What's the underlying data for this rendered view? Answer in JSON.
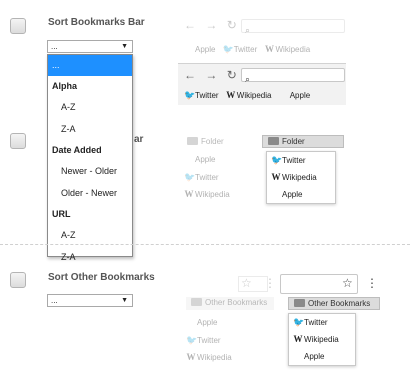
{
  "options": [
    {
      "title": "Sort Bookmarks Bar",
      "value": "...",
      "caret": "▼"
    },
    {
      "title_visible": "ar"
    },
    {
      "title": "Sort Other Bookmarks",
      "value": "...",
      "caret": "▼"
    }
  ],
  "dropdown": {
    "items": [
      {
        "label": "...",
        "kind": "selected"
      },
      {
        "label": "Alpha",
        "kind": "group"
      },
      {
        "label": "A-Z",
        "kind": "sub"
      },
      {
        "label": "Z-A",
        "kind": "sub"
      },
      {
        "label": "Date Added",
        "kind": "group"
      },
      {
        "label": "Newer - Older",
        "kind": "sub"
      },
      {
        "label": "Older - Newer",
        "kind": "sub"
      },
      {
        "label": "URL",
        "kind": "group"
      },
      {
        "label": "A-Z",
        "kind": "sub"
      },
      {
        "label": "Z-A",
        "kind": "sub"
      }
    ]
  },
  "preview1": {
    "before": [
      "Apple",
      "Twitter",
      "Wikipedia"
    ],
    "after": [
      "Twitter",
      "Wikipedia",
      "Apple"
    ]
  },
  "preview2": {
    "folder_label": "Folder",
    "before": [
      "Apple",
      "Twitter",
      "Wikipedia"
    ],
    "after": [
      "Twitter",
      "Wikipedia",
      "Apple"
    ]
  },
  "preview3": {
    "folder_label": "Other Bookmarks",
    "before": [
      "Apple",
      "Twitter",
      "Wikipedia"
    ],
    "after": [
      "Twitter",
      "Wikipedia",
      "Apple"
    ]
  },
  "icons": {
    "back": "←",
    "forward": "→",
    "reload": "↻",
    "search": "⌕",
    "star": "☆",
    "more": "⋮",
    "twitter": "🐦",
    "wikipedia": "W",
    "apple": ""
  },
  "colors": {
    "accent": "#1e90ff",
    "twitter": "#1da1f2"
  }
}
